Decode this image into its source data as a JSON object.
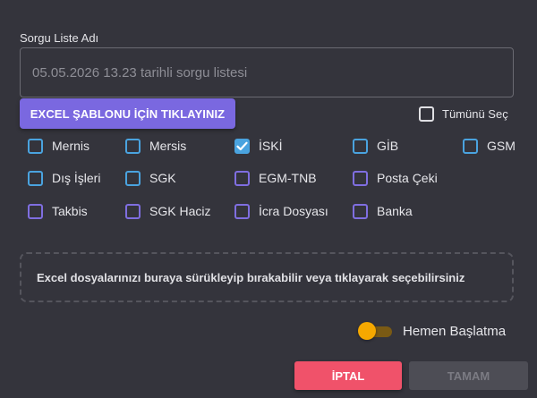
{
  "form": {
    "list_name_label": "Sorgu Liste Adı",
    "list_name_value": "",
    "list_name_placeholder": "05.05.2026 13.23 tarihli sorgu listesi"
  },
  "excel_template_button": "EXCEL ŞABLONU İÇİN TIKLAYINIZ",
  "select_all": {
    "label": "Tümünü Seç",
    "checked": false
  },
  "sources": [
    {
      "label": "Mernis",
      "checked": false,
      "color": "#4aa3df"
    },
    {
      "label": "Mersis",
      "checked": false,
      "color": "#4aa3df"
    },
    {
      "label": "İSKİ",
      "checked": true,
      "color": "#4aa3df"
    },
    {
      "label": "GİB",
      "checked": false,
      "color": "#4aa3df"
    },
    {
      "label": "GSM",
      "checked": false,
      "color": "#4aa3df"
    },
    {
      "label": "Dış İşleri",
      "checked": false,
      "color": "#4aa3df"
    },
    {
      "label": "SGK",
      "checked": false,
      "color": "#4aa3df"
    },
    {
      "label": "EGM-TNB",
      "checked": false,
      "color": "#7f6ee0"
    },
    {
      "label": "Posta Çeki",
      "checked": false,
      "color": "#7f6ee0"
    },
    {
      "label": "Takbis",
      "checked": false,
      "color": "#7f6ee0"
    },
    {
      "label": "SGK Haciz",
      "checked": false,
      "color": "#7f6ee0"
    },
    {
      "label": "İcra Dosyası",
      "checked": false,
      "color": "#7f6ee0"
    },
    {
      "label": "Banka",
      "checked": false,
      "color": "#7f6ee0"
    }
  ],
  "dropzone_text": "Excel dosyalarınızı buraya sürükleyip bırakabilir veya tıklayarak seçebilirsiniz",
  "start_now": {
    "label": "Hemen Başlatma",
    "on": true
  },
  "buttons": {
    "cancel": "İPTAL",
    "ok": "TAMAM"
  },
  "colors": {
    "background": "#34343c",
    "excel_button": "#7a68e0",
    "cancel_button": "#f0526a",
    "ok_button_disabled": "#4d4d55",
    "checkbox_blue": "#4aa3df",
    "checkbox_purple": "#7f6ee0",
    "toggle_on": "#f5a800"
  }
}
